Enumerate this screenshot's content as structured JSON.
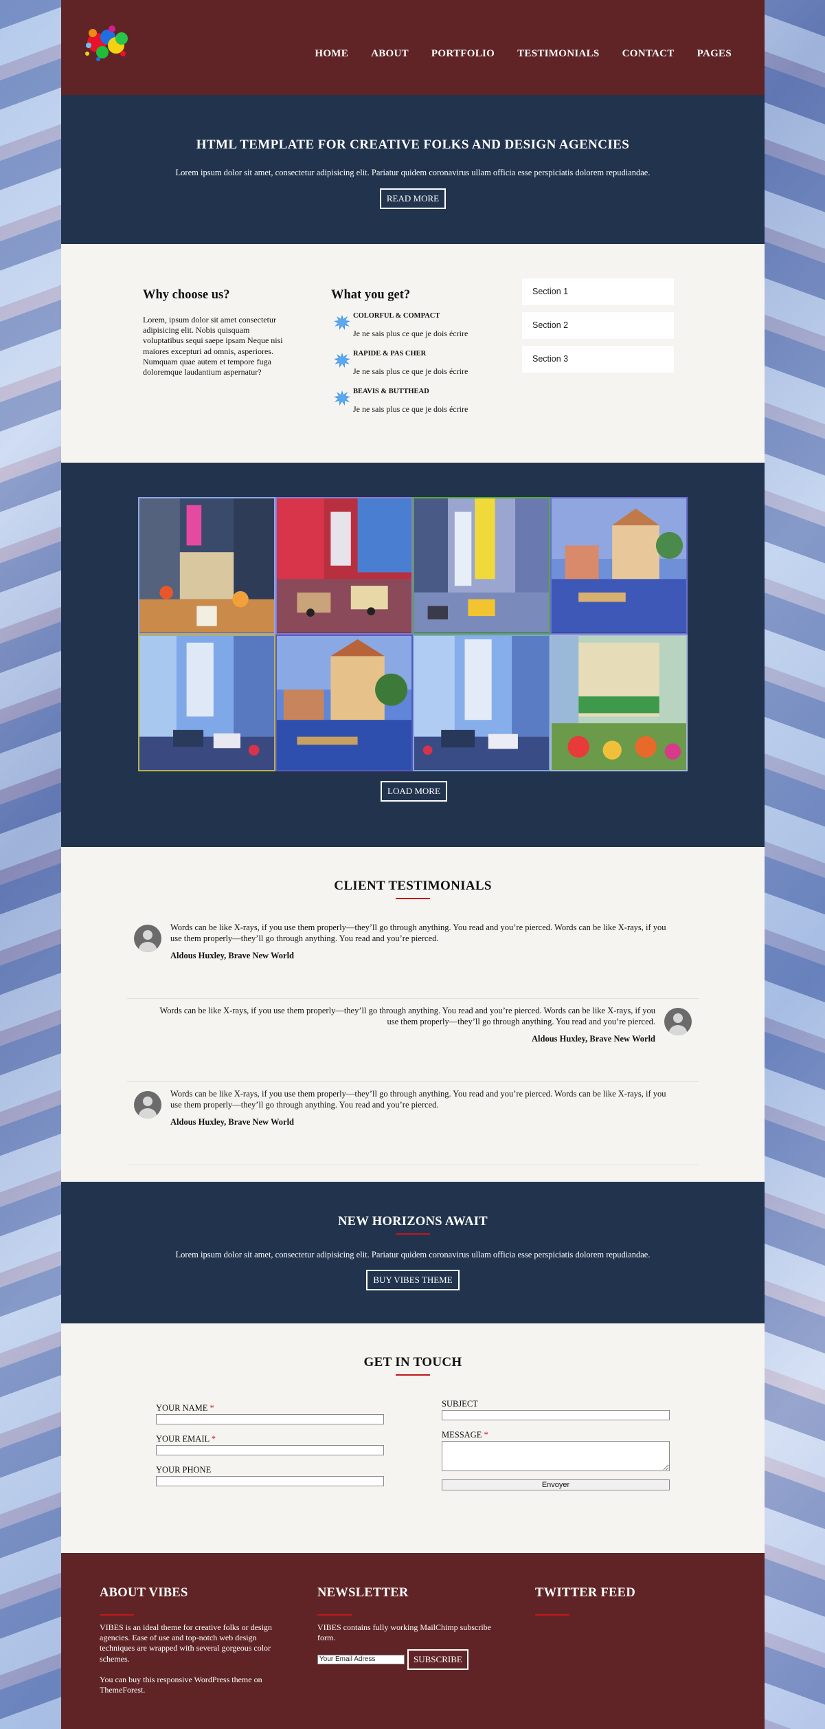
{
  "nav": [
    "HOME",
    "ABOUT",
    "PORTFOLIO",
    "TESTIMONIALS",
    "CONTACT",
    "PAGES"
  ],
  "hero": {
    "title": "HTML TEMPLATE FOR CREATIVE FOLKS AND DESIGN AGENCIES",
    "text": "Lorem ipsum dolor sit amet, consectetur adipisicing elit. Pariatur quidem coronavirus ullam officia esse perspiciatis dolorem repudiandae.",
    "button": "READ MORE"
  },
  "why": {
    "title": "Why choose us?",
    "text": "Lorem, ipsum dolor sit amet consectetur adipisicing elit. Nobis quisquam voluptatibus sequi saepe ipsam Neque nisi maiores excepturi ad omnis, asperiores. Numquam quae autem et tempore fuga doloremque laudantium aspernatur?"
  },
  "get": {
    "title": "What you get?",
    "items": [
      {
        "title": "COLORFUL & COMPACT",
        "desc": "Je ne sais plus ce que je dois écrire"
      },
      {
        "title": "RAPIDE & PAS CHER",
        "desc": "Je ne sais plus ce que je dois écrire"
      },
      {
        "title": "BEAVIS & BUTTHEAD",
        "desc": "Je ne sais plus ce que je dois écrire"
      }
    ]
  },
  "sections": [
    "Section 1",
    "Section 2",
    "Section 3"
  ],
  "portfolio": {
    "button": "LOAD MORE"
  },
  "testimonials": {
    "title": "CLIENT TESTIMONIALS",
    "items": [
      {
        "quote": "Words can be like X-rays, if you use them properly—they’ll go through anything. You read and you’re pierced. Words can be like X-rays, if you use them properly—they’ll go through anything. You read and you’re pierced.",
        "author": "Aldous Huxley, Brave New World"
      },
      {
        "quote": "Words can be like X-rays, if you use them properly—they’ll go through anything. You read and you’re pierced. Words can be like X-rays, if you use them properly—they’ll go through anything. You read and you’re pierced.",
        "author": "Aldous Huxley, Brave New World"
      },
      {
        "quote": "Words can be like X-rays, if you use them properly—they’ll go through anything. You read and you’re pierced. Words can be like X-rays, if you use them properly—they’ll go through anything. You read and you’re pierced.",
        "author": "Aldous Huxley, Brave New World"
      }
    ]
  },
  "cta": {
    "title": "NEW HORIZONS AWAIT",
    "text": "Lorem ipsum dolor sit amet, consectetur adipisicing elit. Pariatur quidem coronavirus ullam officia esse perspiciatis dolorem repudiandae.",
    "button": "BUY VIBES THEME"
  },
  "contact": {
    "title": "GET IN TOUCH",
    "name_label": "YOUR NAME",
    "email_label": "YOUR EMAIL",
    "phone_label": "YOUR PHONE",
    "subject_label": "SUBJECT",
    "message_label": "MESSAGE",
    "required_mark": "*",
    "submit": "Envoyer"
  },
  "footer": {
    "about_title": "ABOUT VIBES",
    "about_p1": "VIBES is an ideal theme for creative folks or design agencies. Ease of use and top-notch web design techniques are wrapped with several gorgeous color schemes.",
    "about_p2": "You can buy this responsive WordPress theme on ThemeForest.",
    "newsletter_title": "NEWSLETTER",
    "newsletter_text": "VIBES contains fully working MailChimp subscribe form.",
    "email_placeholder": "Your Email Adress",
    "subscribe": "SUBSCRIBE",
    "twitter_title": "TWITTER FEED"
  },
  "colors": {
    "header_bg": "#602426",
    "dark_section_bg": "#22344d",
    "light_section_bg": "#f6f4f0",
    "accent_red": "#c0181b"
  }
}
